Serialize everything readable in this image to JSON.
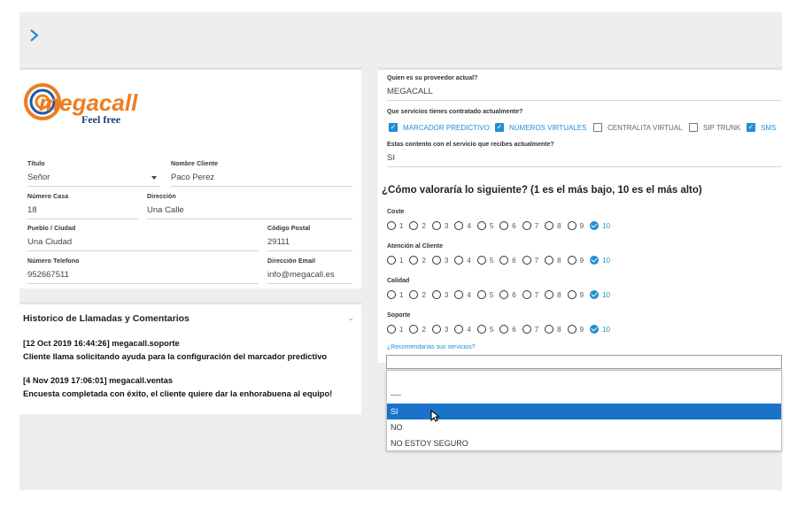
{
  "nav": {
    "expand_icon": "chevron-right-icon"
  },
  "brand": {
    "name": "megacall",
    "tagline": "Feel free",
    "color": "#ee7d1f"
  },
  "customer": {
    "title": {
      "label": "Título",
      "value": "Señor"
    },
    "name": {
      "label": "Nombre Cliente",
      "value": "Paco Perez"
    },
    "house_number": {
      "label": "Número Casa",
      "value": "18"
    },
    "address": {
      "label": "Dirección",
      "value": "Una Calle"
    },
    "city": {
      "label": "Pueblo / Ciudad",
      "value": "Una Ciudad"
    },
    "postal_code": {
      "label": "Código Postal",
      "value": "29111"
    },
    "phone": {
      "label": "Número Telefono",
      "value": "952667511"
    },
    "email": {
      "label": "Dirección Email",
      "value": "info@megacall.es"
    }
  },
  "history": {
    "title": "Historico de Llamadas y Comentarios",
    "entries": [
      {
        "header": "[12 Oct 2019 16:44:26] megacall.soporte",
        "text": "Cliente llama solicitando ayuda para la configuración del marcador predictivo"
      },
      {
        "header": "[4 Nov 2019 17:06:01] megacall.ventas",
        "text": "Encuesta completada con éxito, el cliente quiere dar la enhorabuena al equipo!"
      }
    ]
  },
  "survey": {
    "provider": {
      "label": "Quien es su proveedor actual?",
      "value": "MEGACALL"
    },
    "services_label": "Que servicios tienes contratado actualmente?",
    "services": [
      {
        "label": "MARCADOR PREDICTIVO",
        "checked": true
      },
      {
        "label": "NÚMEROS VIRTUALES",
        "checked": true
      },
      {
        "label": "CENTRALITA VIRTUAL",
        "checked": false
      },
      {
        "label": "SIP TRUNK",
        "checked": false
      },
      {
        "label": "SMS",
        "checked": true
      }
    ],
    "satisfied": {
      "label": "Estas contento con el servicio que recibes actualmente?",
      "value": "SI"
    },
    "question": "¿Cómo valoraría lo siguiente? (1 es el más bajo, 10 es el más alto)",
    "ratings": [
      {
        "label": "Coste",
        "selected": 10
      },
      {
        "label": "Atención al Cliente",
        "selected": 10
      },
      {
        "label": "Calidad",
        "selected": 10
      },
      {
        "label": "Soporte",
        "selected": 10
      }
    ],
    "scale": [
      "1",
      "2",
      "3",
      "4",
      "5",
      "6",
      "7",
      "8",
      "9",
      "10"
    ],
    "recommend": {
      "label": "¿Recomendarías sus servicios?",
      "options": [
        "----",
        "SI",
        "NO",
        "NO ESTOY SEGURO"
      ],
      "highlighted": "SI"
    }
  },
  "colors": {
    "accent": "#1f8fd6",
    "highlight": "#1a73c9"
  }
}
